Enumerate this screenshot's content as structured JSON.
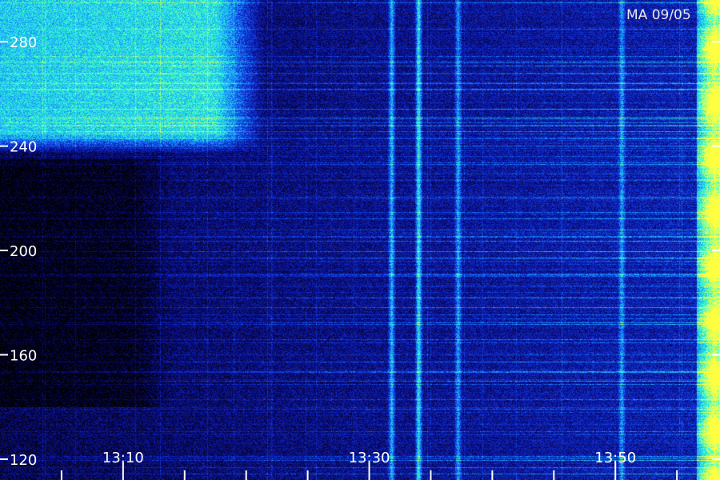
{
  "chart_data": {
    "type": "heatmap",
    "title": "",
    "station_label": "MA 09/05",
    "xlabel": "",
    "ylabel": "",
    "x_ticks": [
      "13:10",
      "13:30",
      "13:50"
    ],
    "x_tick_minutes": [
      10,
      30,
      50
    ],
    "xlim_minutes": [
      0,
      58.5
    ],
    "y_ticks": [
      120,
      160,
      200,
      240,
      280
    ],
    "ylim": [
      112,
      296
    ],
    "colormap": [
      "#000000",
      "#0a0a78",
      "#1030d8",
      "#1aa0ff",
      "#30ffd0",
      "#ffff40"
    ],
    "features": [
      {
        "kind": "broadband_glow",
        "x_minutes": [
          0,
          17.5
        ],
        "y_range": [
          245,
          296
        ],
        "intensity": 0.55
      },
      {
        "kind": "quiet_region",
        "x_minutes": [
          0,
          14
        ],
        "y_range": [
          140,
          235
        ],
        "intensity": 0.05
      },
      {
        "kind": "vertical_band",
        "x_minute": 31.8,
        "intensity": 0.42
      },
      {
        "kind": "vertical_band",
        "x_minute": 34.0,
        "intensity": 0.5
      },
      {
        "kind": "vertical_band",
        "x_minute": 37.2,
        "intensity": 0.35
      },
      {
        "kind": "vertical_band",
        "x_minute": 50.5,
        "intensity": 0.3
      },
      {
        "kind": "strong_band",
        "x_minutes": [
          56.6,
          59.5
        ],
        "intensity": 0.9
      }
    ]
  }
}
